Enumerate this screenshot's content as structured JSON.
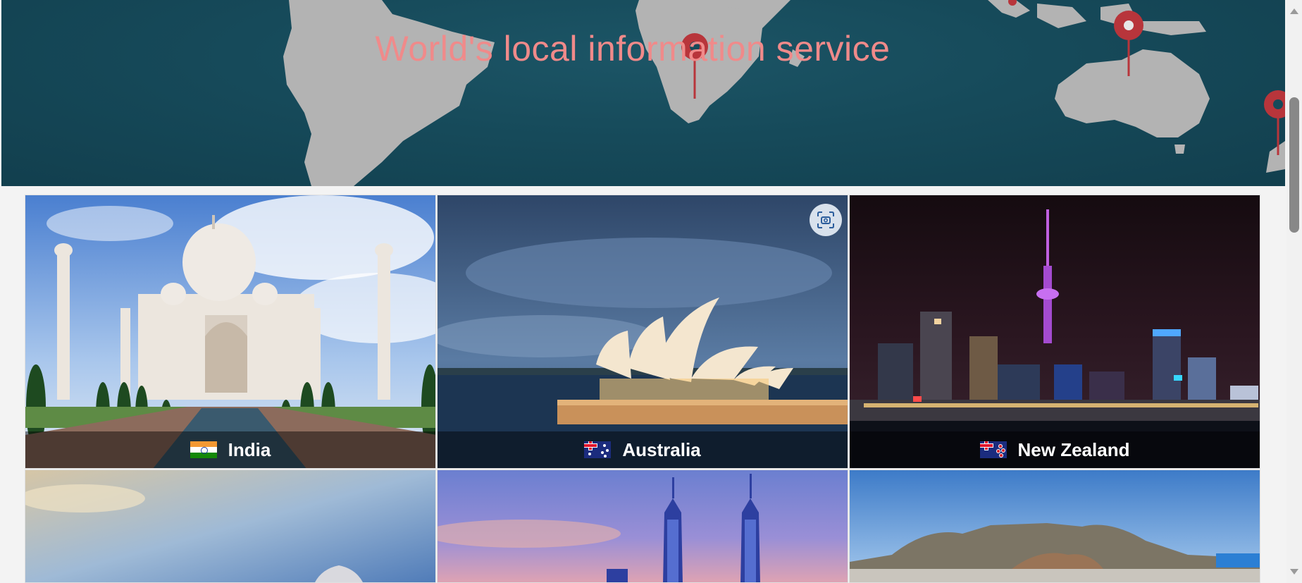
{
  "hero": {
    "title": "World's local information service"
  },
  "destinations": [
    {
      "label": "India",
      "flag": "india-flag"
    },
    {
      "label": "Australia",
      "flag": "australia-flag"
    },
    {
      "label": "New Zealand",
      "flag": "new-zealand-flag"
    },
    {
      "label": "",
      "flag": ""
    },
    {
      "label": "",
      "flag": ""
    },
    {
      "label": "",
      "flag": ""
    }
  ],
  "colors": {
    "hero_bg": "#164a5a",
    "title": "#f08a8a",
    "land": "#b3b3b3",
    "pin": "#b8353b"
  },
  "icons": {
    "visual_search": "lens-scan-icon"
  }
}
